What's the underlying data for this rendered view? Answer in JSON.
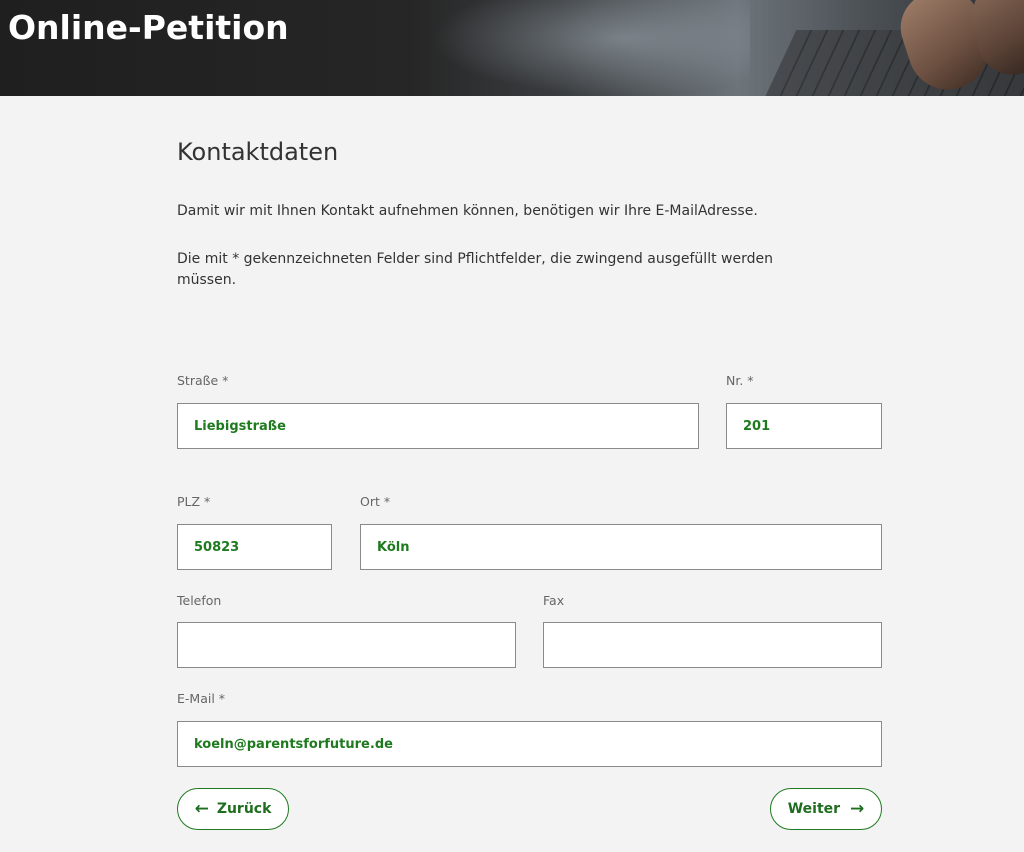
{
  "header": {
    "title": "Online-Petition"
  },
  "main": {
    "title": "Kontaktdaten",
    "intro": "Damit wir mit Ihnen Kontakt aufnehmen können, benötigen wir Ihre E-MailAdresse.",
    "required_note_line1": "Die mit * gekennzeichneten Felder sind Pflichtfelder, die zwingend ausgefüllt werden",
    "required_note_line2": "müssen."
  },
  "form": {
    "strasse": {
      "label": "Straße *",
      "value": "Liebigstraße"
    },
    "nr": {
      "label": "Nr. *",
      "value": "201"
    },
    "plz": {
      "label": "PLZ *",
      "value": "50823"
    },
    "ort": {
      "label": "Ort *",
      "value": "Köln"
    },
    "telefon": {
      "label": "Telefon",
      "value": ""
    },
    "fax": {
      "label": "Fax",
      "value": ""
    },
    "email": {
      "label": "E-Mail *",
      "value": "koeln@parentsforfuture.de"
    }
  },
  "buttons": {
    "back_label": "Zurück",
    "back_icon": "←",
    "next_label": "Weiter",
    "next_icon": "→"
  },
  "colors": {
    "accent": "#1f7a1f",
    "background": "#f3f3f3",
    "header_bg": "#1f1f1f"
  }
}
